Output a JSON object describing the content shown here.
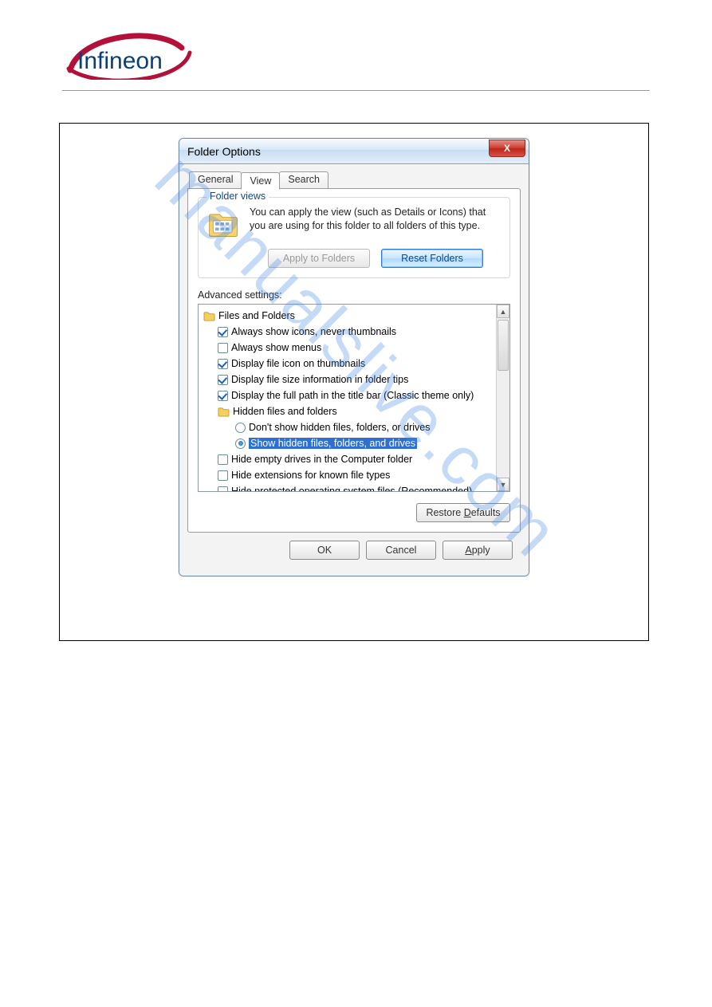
{
  "logo_text": "Infineon",
  "watermark": "manualslive.com",
  "dialog": {
    "title": "Folder Options",
    "close_label": "X",
    "tabs": [
      {
        "label": "General",
        "active": false
      },
      {
        "label": "View",
        "active": true
      },
      {
        "label": "Search",
        "active": false
      }
    ],
    "folder_views": {
      "group_title": "Folder views",
      "description": "You can apply the view (such as Details or Icons) that you are using for this folder to all folders of this type.",
      "apply_button": "Apply to Folders",
      "reset_button": "Reset Folders"
    },
    "advanced_label": "Advanced settings:",
    "tree": {
      "root_label": "Files and Folders",
      "items": [
        {
          "type": "checkbox",
          "checked": true,
          "label": "Always show icons, never thumbnails"
        },
        {
          "type": "checkbox",
          "checked": false,
          "label": "Always show menus"
        },
        {
          "type": "checkbox",
          "checked": true,
          "label": "Display file icon on thumbnails"
        },
        {
          "type": "checkbox",
          "checked": true,
          "label": "Display file size information in folder tips"
        },
        {
          "type": "checkbox",
          "checked": true,
          "label": "Display the full path in the title bar (Classic theme only)"
        },
        {
          "type": "folder",
          "label": "Hidden files and folders",
          "children": [
            {
              "type": "radio",
              "checked": false,
              "label": "Don't show hidden files, folders, or drives"
            },
            {
              "type": "radio",
              "checked": true,
              "label": "Show hidden files, folders, and drives",
              "selected": true
            }
          ]
        },
        {
          "type": "checkbox",
          "checked": false,
          "label": "Hide empty drives in the Computer folder"
        },
        {
          "type": "checkbox",
          "checked": false,
          "label": "Hide extensions for known file types"
        },
        {
          "type": "checkbox",
          "checked": false,
          "label": "Hide protected operating system files (Recommended)"
        }
      ]
    },
    "restore_defaults": "Restore Defaults",
    "restore_defaults_mn": "D",
    "footer": {
      "ok": "OK",
      "cancel": "Cancel",
      "apply": "Apply",
      "apply_mn": "A"
    }
  }
}
